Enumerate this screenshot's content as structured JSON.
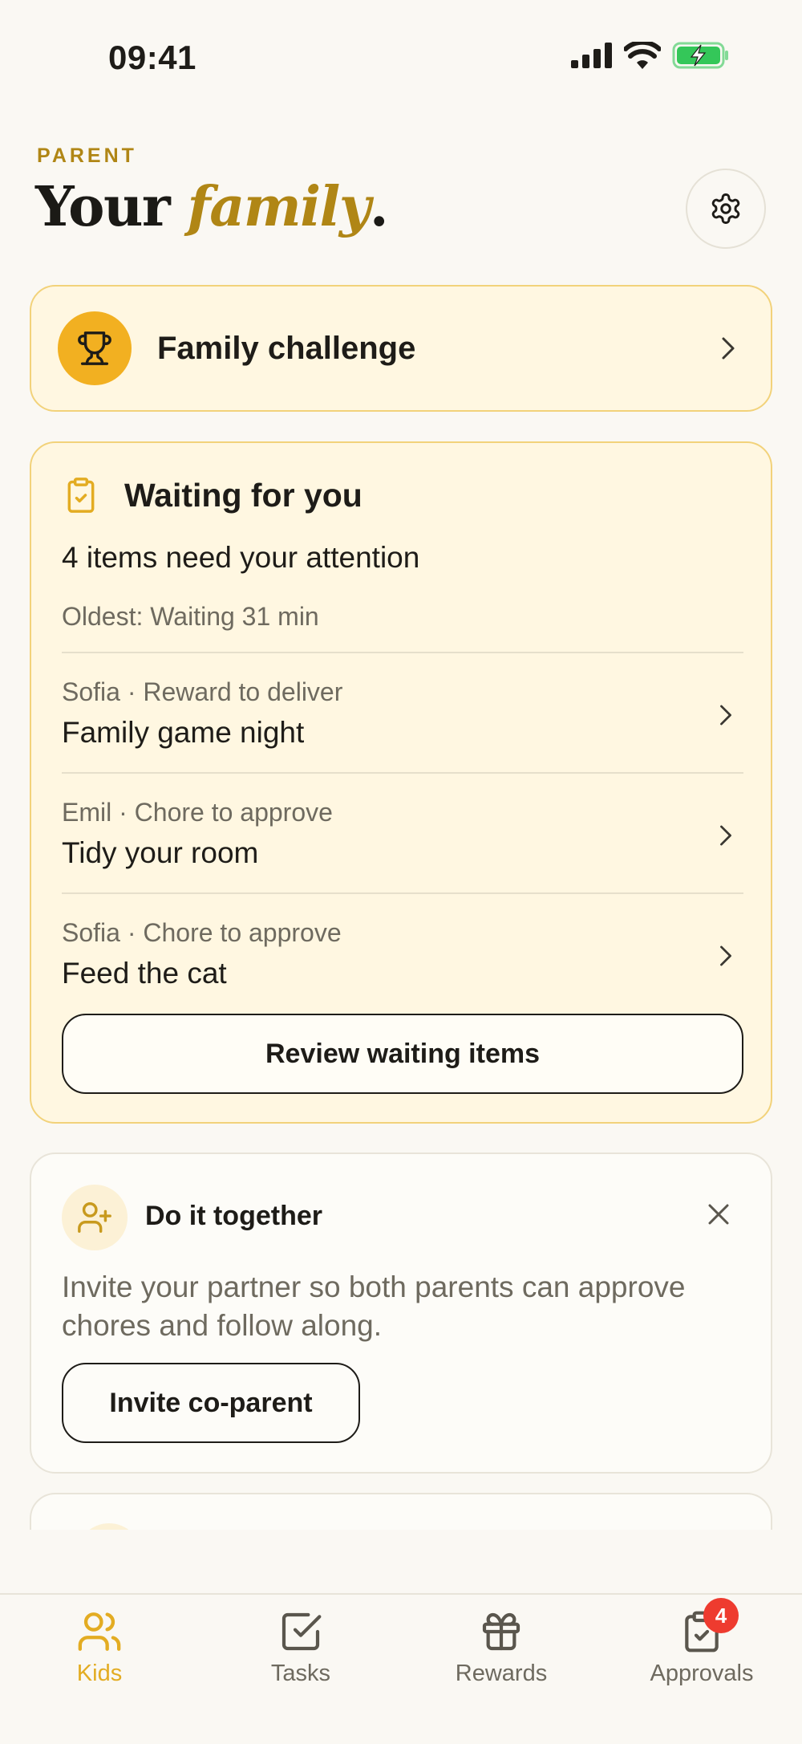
{
  "status_bar": {
    "time": "09:41"
  },
  "header": {
    "eyebrow": "PARENT",
    "title_prefix": "Your ",
    "title_accent": "family",
    "title_suffix": "."
  },
  "challenge": {
    "label": "Family challenge"
  },
  "waiting": {
    "title": "Waiting for you",
    "summary": "4 items need your attention",
    "oldest": "Oldest: Waiting 31 min",
    "items": [
      {
        "meta": "Sofia · Reward to deliver",
        "name": "Family game night"
      },
      {
        "meta": "Emil · Chore to approve",
        "name": "Tidy your room"
      },
      {
        "meta": "Sofia · Chore to approve",
        "name": "Feed the cat"
      }
    ],
    "review_label": "Review waiting items"
  },
  "together": {
    "title": "Do it together",
    "description": "Invite your partner so both parents can approve chores and follow along.",
    "invite_label": "Invite co-parent"
  },
  "tabs": [
    {
      "label": "Kids",
      "icon": "users-icon",
      "active": true
    },
    {
      "label": "Tasks",
      "icon": "checkbox-icon",
      "active": false
    },
    {
      "label": "Rewards",
      "icon": "gift-icon",
      "active": false
    },
    {
      "label": "Approvals",
      "icon": "clipboard-check-icon",
      "active": false,
      "badge": "4"
    }
  ],
  "colors": {
    "accent": "#B08615",
    "tab_active": "#E3AC22",
    "card_highlight": "#FFF7E1",
    "badge": "#EE3B2F",
    "battery": "#34C759"
  }
}
